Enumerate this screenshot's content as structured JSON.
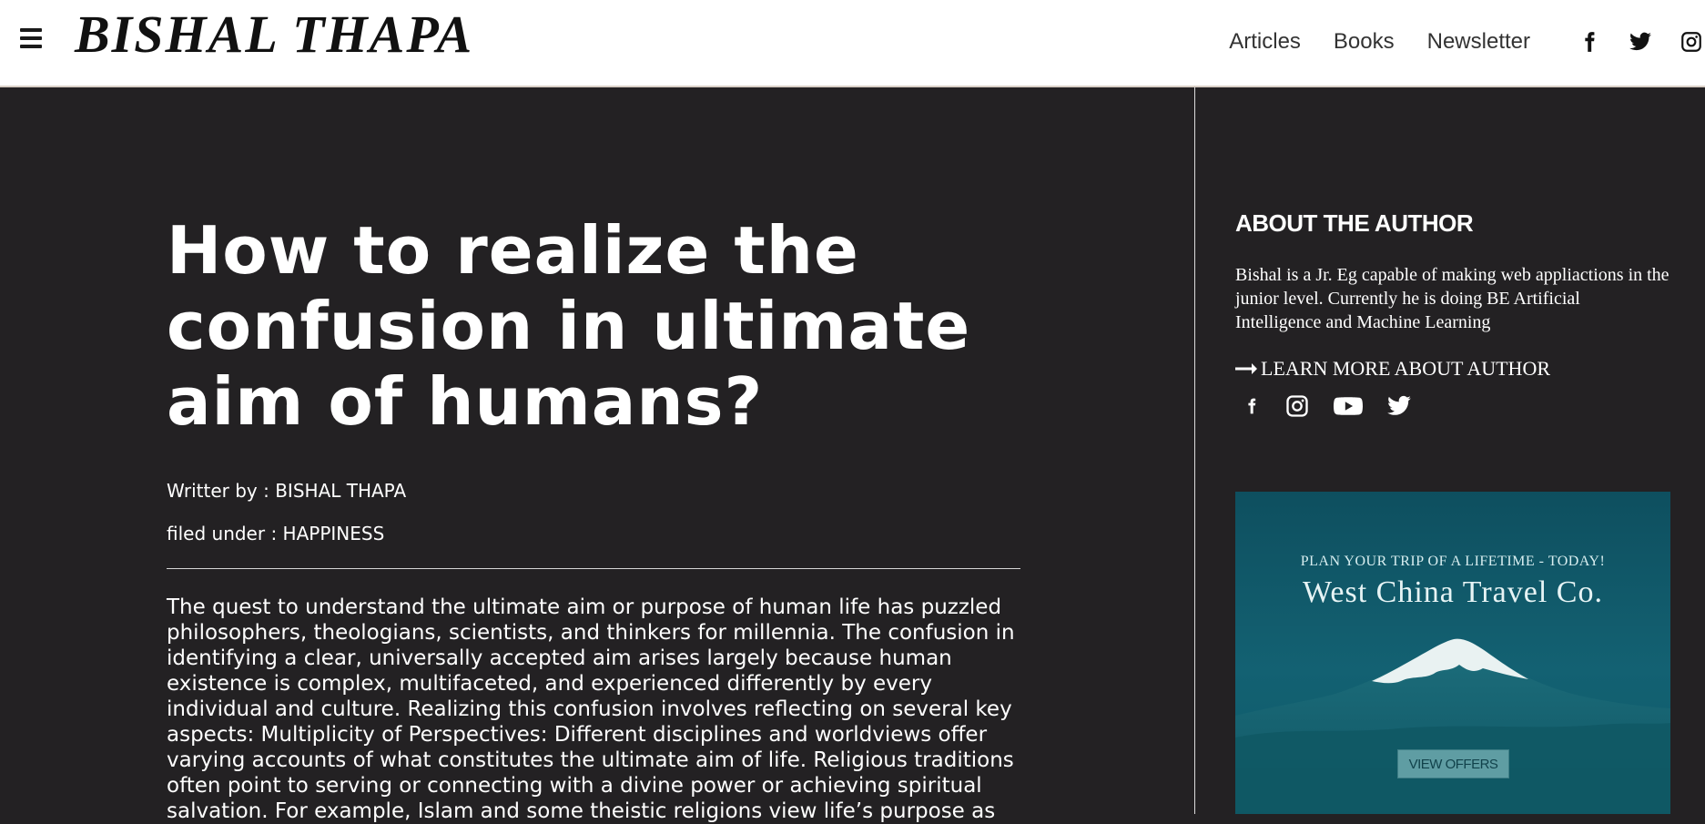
{
  "header": {
    "menu_icon": "hamburger-menu-icon",
    "logo": "BISHAL THAPA",
    "nav": [
      "Articles",
      "Books",
      "Newsletter"
    ],
    "social_icons": [
      "facebook-icon",
      "twitter-icon",
      "instagram-icon"
    ]
  },
  "article": {
    "title": "How to realize the confusion in ultimate aim of humans?",
    "author_line": "Writter by : BISHAL THAPA",
    "filed_line": "filed under : HAPPINESS",
    "body": "The quest to understand the ultimate aim or purpose of human life has puzzled philosophers, theologians, scientists, and thinkers for millennia. The confusion in identifying a clear, universally accepted aim arises largely because human existence is complex, multifaceted, and experienced differently by every individual and culture. Realizing this confusion involves reflecting on several key aspects: Multiplicity of Perspectives: Different disciplines and worldviews offer varying accounts of what constitutes the ultimate aim of life. Religious traditions often point to serving or connecting with a divine power or achieving spiritual salvation. For example, Islam and some theistic religions view life’s purpose as"
  },
  "sidebar": {
    "about_heading": "ABOUT THE AUTHOR",
    "about_text": "Bishal is a Jr. Eg capable of making web appliactions in the junior level. Currently he is doing BE Artificial Intelligence and Machine Learning",
    "learn_more": "LEARN MORE ABOUT AUTHOR",
    "social_icons": [
      "facebook-icon",
      "instagram-icon",
      "youtube-icon",
      "twitter-icon"
    ],
    "ad": {
      "tagline": "PLAN YOUR TRIP OF A LIFETIME - TODAY!",
      "brand": "West China Travel Co.",
      "button": "VIEW OFFERS"
    }
  },
  "colors": {
    "page_bg": "#232123",
    "header_bg": "#ffffff",
    "text": "#ffffff",
    "ad_bg": "#136172"
  }
}
